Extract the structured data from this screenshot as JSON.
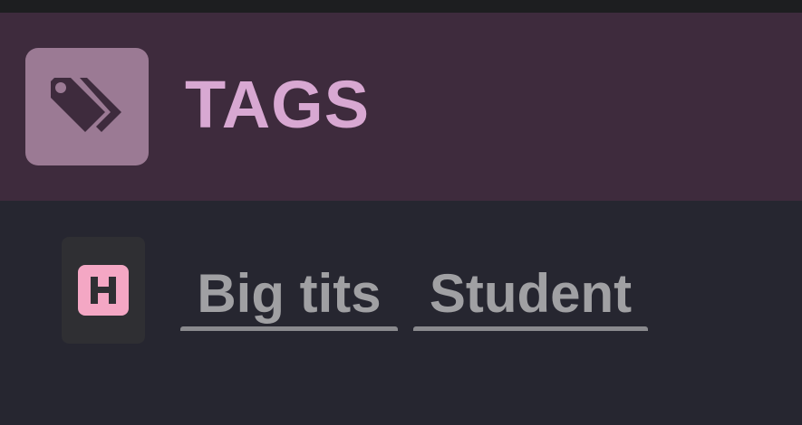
{
  "header": {
    "title": "TAGS",
    "icon": "tags-icon"
  },
  "content": {
    "badge_icon": "h-icon",
    "tags": [
      {
        "label": "Big tits"
      },
      {
        "label": "Student"
      }
    ]
  },
  "colors": {
    "header_bg": "#3e2b3d",
    "header_icon_bg": "#9b7a94",
    "title": "#d8a8d2",
    "content_bg": "#262630",
    "tag_text": "#a0a0a3",
    "badge_accent": "#f4a7c4"
  }
}
